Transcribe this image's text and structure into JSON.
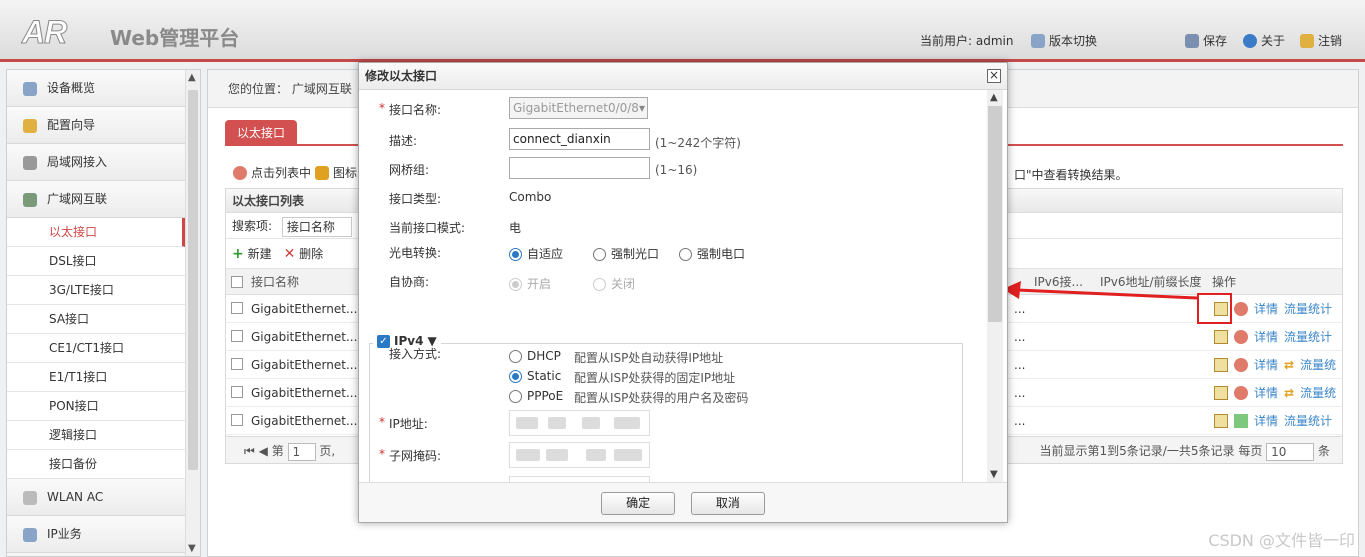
{
  "app": {
    "logo": "AR",
    "title": "Web管理平台"
  },
  "header": {
    "current_user": "当前用户: admin",
    "version_switch": "版本切换",
    "save": "保存",
    "about": "关于",
    "logout": "注销"
  },
  "nav": {
    "top_items": [
      "设备概览",
      "配置向导",
      "局域网接入",
      "广域网互联"
    ],
    "sub_items": [
      "以太接口",
      "DSL接口",
      "3G/LTE接口",
      "SA接口",
      "CE1/CT1接口",
      "E1/T1接口",
      "PON接口",
      "逻辑接口",
      "接口备份"
    ],
    "bottom_items": [
      "WLAN AC",
      "IP业务"
    ]
  },
  "main": {
    "breadcrumb": "您的位置： 广域网互联",
    "tab": "以太接口",
    "tip_left": "点击列表中",
    "tip_icon": "图标",
    "tip_right": "口\"中查看转换结果。",
    "table_title": "以太接口列表",
    "search_label": "搜索项:",
    "search_value": "接口名称",
    "toolbar": {
      "new": "新建",
      "delete": "删除"
    },
    "columns": {
      "name": "接口名称",
      "ipv6": "IPv6接...",
      "ipv6prefix": "IPv6地址/前缀长度",
      "ops": "操作"
    },
    "rows": [
      {
        "name": "GigabitEthernet...",
        "dots": "...",
        "mode": "stop",
        "switch": false,
        "details": "详情",
        "stats": "流量统计"
      },
      {
        "name": "GigabitEthernet...",
        "dots": "...",
        "mode": "stop",
        "switch": false,
        "details": "详情",
        "stats": "流量统计"
      },
      {
        "name": "GigabitEthernet...",
        "dots": "...",
        "mode": "stop",
        "switch": true,
        "details": "详情",
        "stats": "流量统"
      },
      {
        "name": "GigabitEthernet...",
        "dots": "...",
        "mode": "stop",
        "switch": true,
        "details": "详情",
        "stats": "流量统"
      },
      {
        "name": "GigabitEthernet...",
        "dots": "...",
        "mode": "start",
        "switch": false,
        "details": "详情",
        "stats": "流量统计"
      }
    ],
    "pager": {
      "page_label": "第",
      "page": "1",
      "page_suffix": "页,",
      "summary": "当前显示第1到5条记录/一共5条记录",
      "per_page_label": "每页",
      "per_page": "10",
      "per_page_suffix": "条"
    }
  },
  "dialog": {
    "title": "修改以太接口",
    "fields": {
      "name_label": "接口名称:",
      "name_value": "GigabitEthernet0/0/8",
      "desc_label": "描述:",
      "desc_value": "connect_dianxin",
      "desc_hint": "(1~242个字符)",
      "bridge_label": "网桥组:",
      "bridge_value": "",
      "bridge_hint": "(1~16)",
      "type_label": "接口类型:",
      "type_value": "Combo",
      "mode_label": "当前接口模式:",
      "mode_value": "电",
      "convert_label": "光电转换:",
      "convert_options": [
        "自适应",
        "强制光口",
        "强制电口"
      ],
      "autoneg_label": "自协商:",
      "autoneg_options": [
        "开启",
        "关闭"
      ],
      "ipv4_legend": "IPv4",
      "access_label": "接入方式:",
      "access_options": [
        {
          "name": "DHCP",
          "desc": "配置从ISP处自动获得IP地址"
        },
        {
          "name": "Static",
          "desc": "配置从ISP处获得的固定IP地址"
        },
        {
          "name": "PPPoE",
          "desc": "配置从ISP处获得的用户名及密码"
        }
      ],
      "ip_label": "IP地址:",
      "mask_label": "子网掩码:"
    },
    "ok": "确定",
    "cancel": "取消"
  },
  "watermark": "CSDN @文件皆一印",
  "colors": {
    "accent": "#d25050",
    "link": "#3a86c8",
    "highlight": "#e02020"
  }
}
